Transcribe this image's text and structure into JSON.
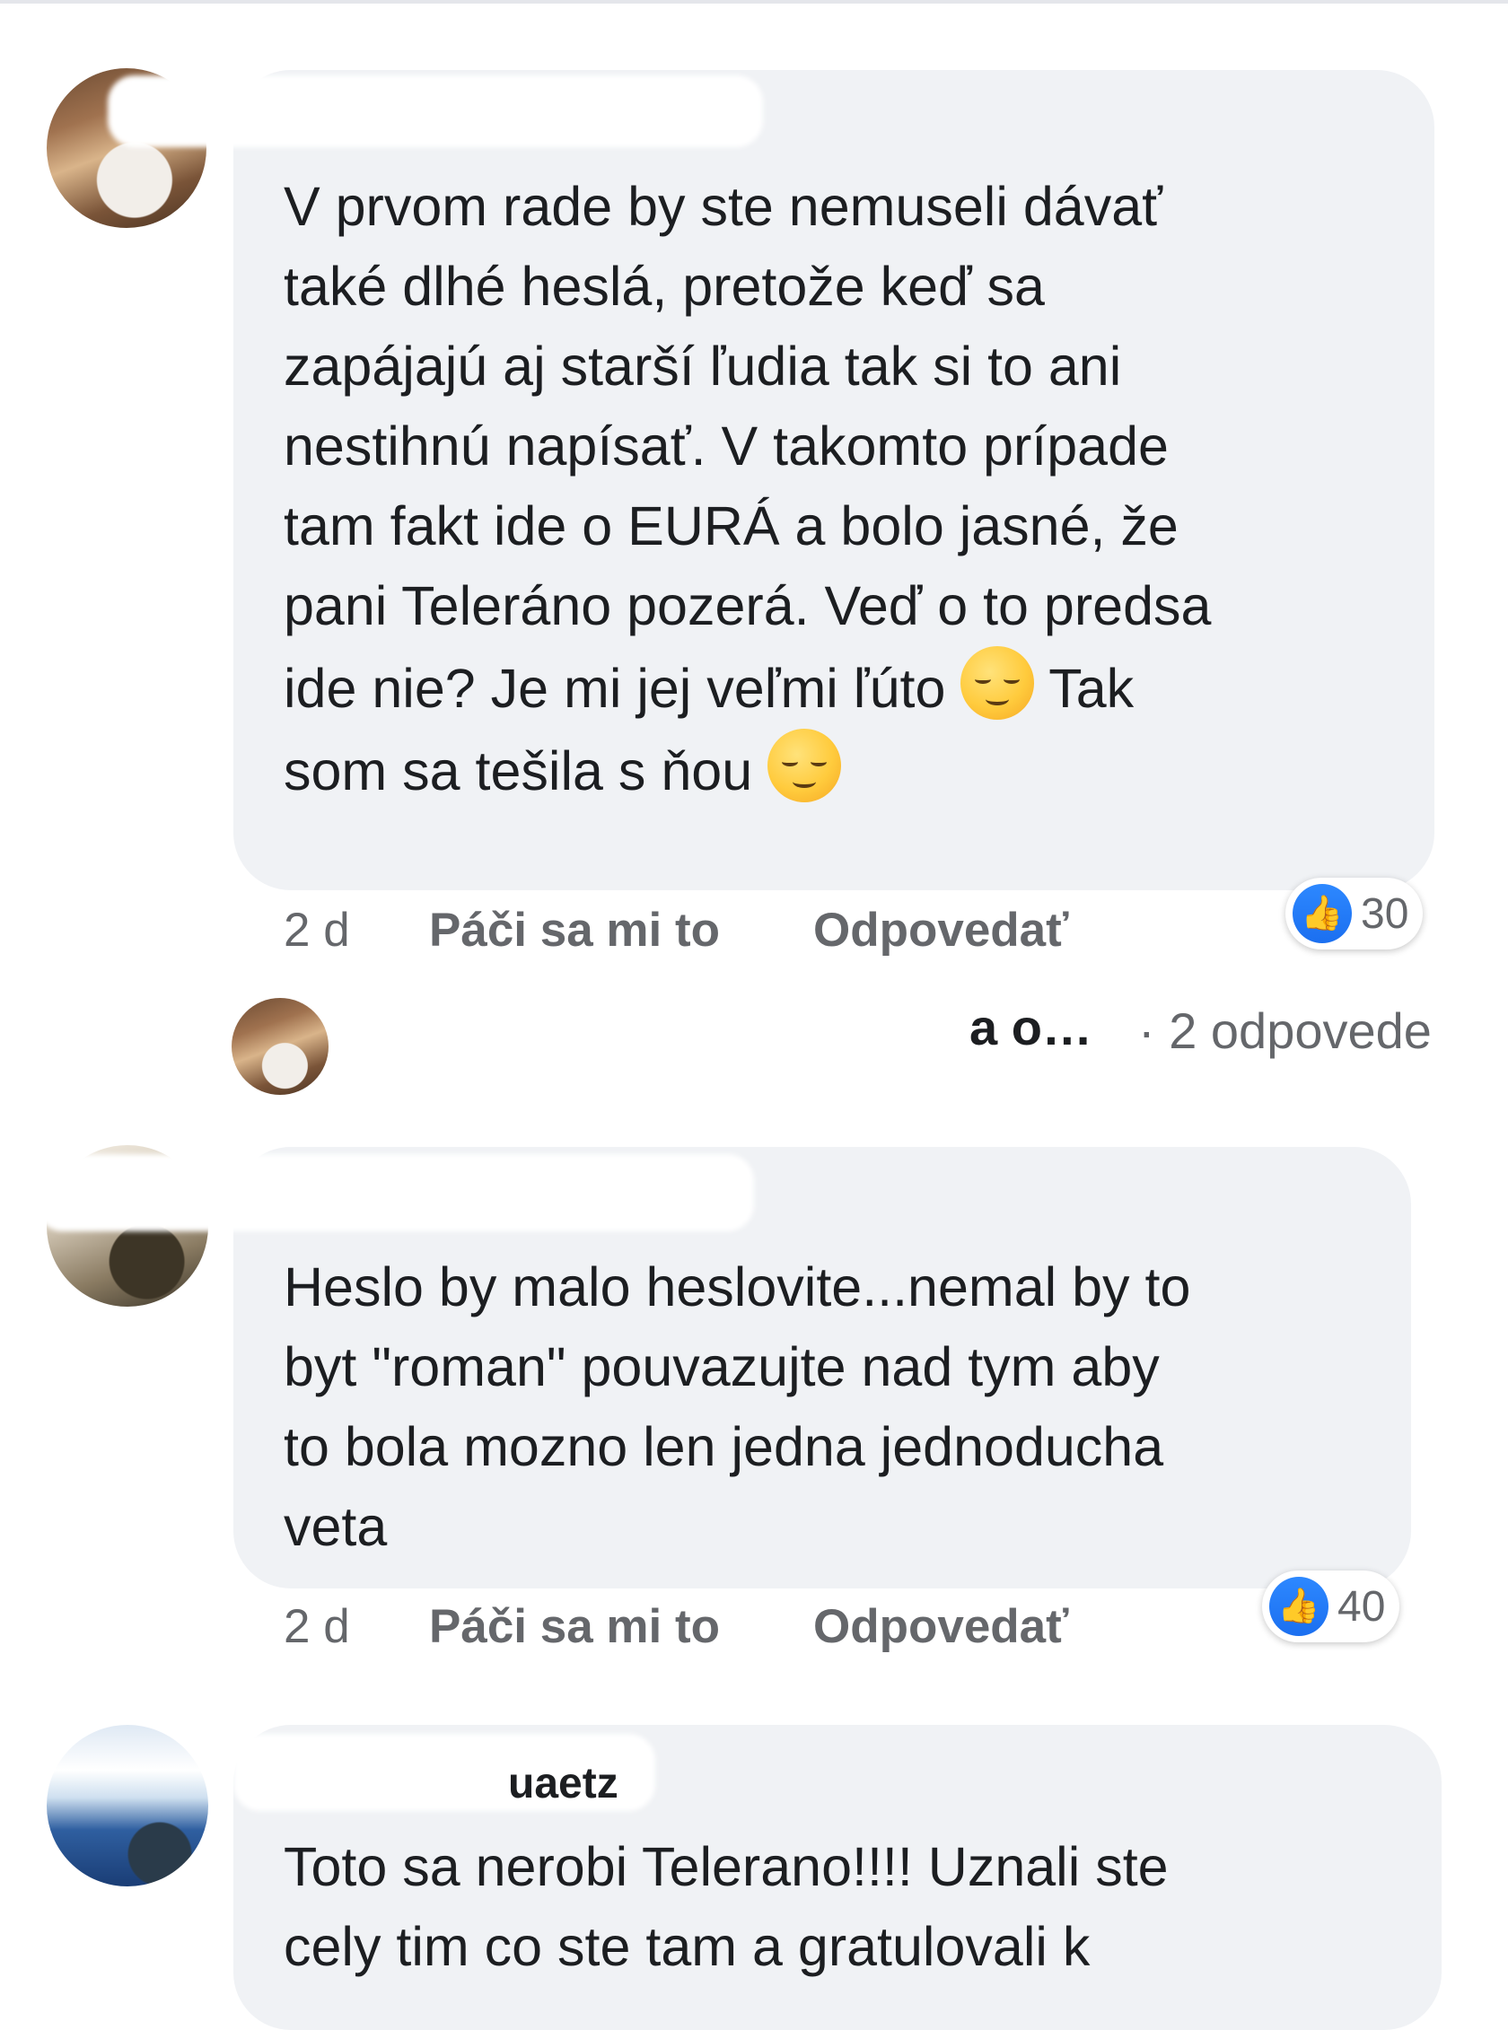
{
  "comments": [
    {
      "name_visible": "",
      "text": "V prvom rade by ste nemuseli dávať\ntaké dlhé heslá, pretože keď sa\nzapájajú aj starší ľudia tak si to ani\nnestihnú napísať. V takomto prípade\ntam fakt ide o EURÁ a bolo jasné, že\npani Teleráno pozerá. Veď o to predsa\nide nie? Je mi jej veľmi ľúto",
      "text_after_emoji1": " Tak\nsom sa tešila s ňou ",
      "emoji1": "smirking-face",
      "emoji2": "relieved-face",
      "time": "2 d",
      "like_label": "Páči sa mi to",
      "reply_label": "Odpovedať",
      "reaction_count": "30",
      "reply_preview_name": "a o…",
      "reply_count_label": "· 2 odpovede"
    },
    {
      "name_visible": "",
      "text": "Heslo by malo heslovite...nemal by to\nbyt \"roman\" pouvazujte nad tym aby\nto bola mozno len jedna jednoducha\nveta",
      "time": "2 d",
      "like_label": "Páči sa mi to",
      "reply_label": "Odpovedať",
      "reaction_count": "40"
    },
    {
      "name_visible": "uaetz",
      "text": "Toto sa nerobi Telerano!!!! Uznali ste\ncely tim co ste tam a gratulovali k"
    }
  ],
  "colors": {
    "bubble": "#f0f2f5",
    "meta_text": "#65676b",
    "like_blue": "#1b74e4"
  }
}
